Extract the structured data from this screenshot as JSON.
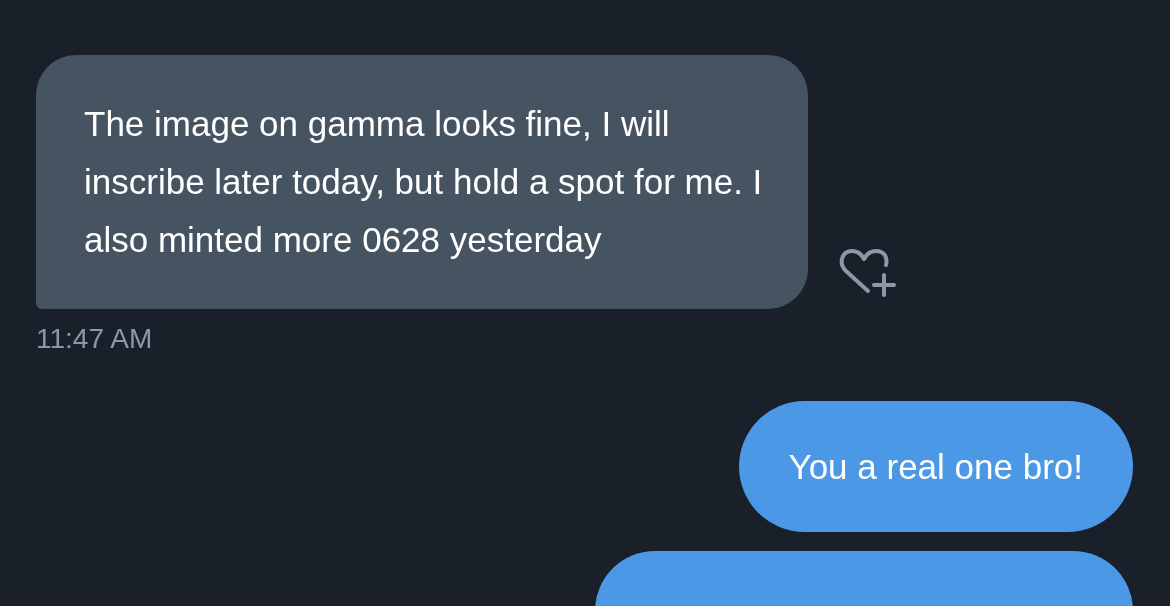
{
  "messages": [
    {
      "kind": "received",
      "text": "The image on gamma looks fine, I will inscribe later today, but hold a spot for me. I also minted more 0628 yesterday",
      "time": "11:47 AM"
    },
    {
      "kind": "sent",
      "text": "You a real one bro!"
    },
    {
      "kind": "sent"
    }
  ]
}
